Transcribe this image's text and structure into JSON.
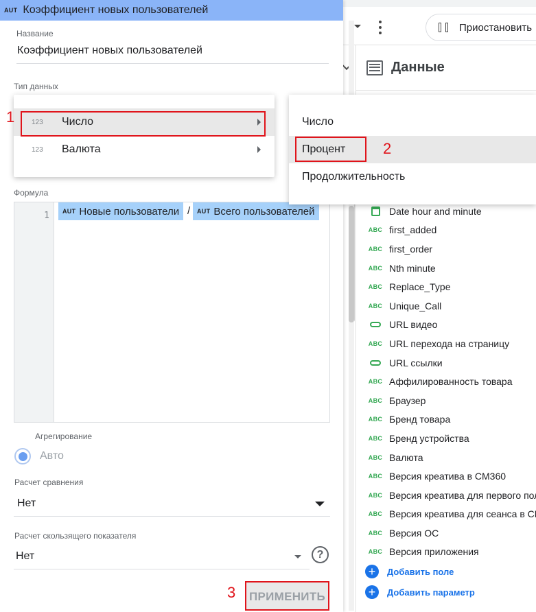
{
  "background": {
    "pause_button_label": "Приостановить",
    "data_panel_title": "Данные",
    "fields": [
      {
        "icon": "calendar-icon",
        "label": "Date hour and minute"
      },
      {
        "icon": "abc-text",
        "label": "first_added"
      },
      {
        "icon": "abc-text",
        "label": "first_order"
      },
      {
        "icon": "abc-text",
        "label": "Nth minute"
      },
      {
        "icon": "abc-text",
        "label": "Replace_Type"
      },
      {
        "icon": "abc-text",
        "label": "Unique_Call"
      },
      {
        "icon": "link-icon",
        "label": "URL видео"
      },
      {
        "icon": "abc-text",
        "label": "URL перехода на страницу"
      },
      {
        "icon": "link-icon",
        "label": "URL ссылки"
      },
      {
        "icon": "abc-text",
        "label": "Аффилированность товара"
      },
      {
        "icon": "abc-text",
        "label": "Браузер"
      },
      {
        "icon": "abc-text",
        "label": "Бренд товара"
      },
      {
        "icon": "abc-text",
        "label": "Бренд устройства"
      },
      {
        "icon": "abc-text",
        "label": "Валюта"
      },
      {
        "icon": "abc-text",
        "label": "Версия креатива в CM360"
      },
      {
        "icon": "abc-text",
        "label": "Версия креатива для первого пол"
      },
      {
        "icon": "abc-text",
        "label": "Версия креатива для сеанса в CM"
      },
      {
        "icon": "abc-text",
        "label": "Версия ОС"
      },
      {
        "icon": "abc-text",
        "label": "Версия приложения"
      }
    ],
    "abc_badge": "ABC",
    "add_field_label": "Добавить поле",
    "add_parameter_label": "Добавить параметр"
  },
  "editor": {
    "header_badge": "AUT",
    "header_title": "Коэффициент новых пользователей",
    "name_label": "Название",
    "name_value": "Коэффициент новых пользователей",
    "data_type_label": "Тип данных",
    "formula_label": "Формула",
    "formula_line_number": "1",
    "formula_chip_badge": "AUT",
    "formula_chip_1": "Новые пользователи",
    "formula_operator": "/",
    "formula_chip_2": "Всего пользователей",
    "aggregation_label": "Агрегирование",
    "aggregation_value": "Авто",
    "comparison_label": "Расчет сравнения",
    "comparison_value": "Нет",
    "running_label": "Расчет скользящего показателя",
    "running_value": "Нет",
    "help_symbol": "?",
    "apply_label": "ПРИМЕНИТЬ"
  },
  "type_menu": {
    "number_badge": "123",
    "items": [
      {
        "label": "Число",
        "highlighted": true
      },
      {
        "label": "Валюта",
        "highlighted": false
      }
    ]
  },
  "number_submenu": {
    "items": [
      {
        "label": "Число",
        "highlighted": false
      },
      {
        "label": "Процент",
        "highlighted": true
      },
      {
        "label": "Продолжительность",
        "highlighted": false
      }
    ]
  },
  "annotations": {
    "step1": "1",
    "step2": "2",
    "step3": "3",
    "color": "#e0141b"
  }
}
